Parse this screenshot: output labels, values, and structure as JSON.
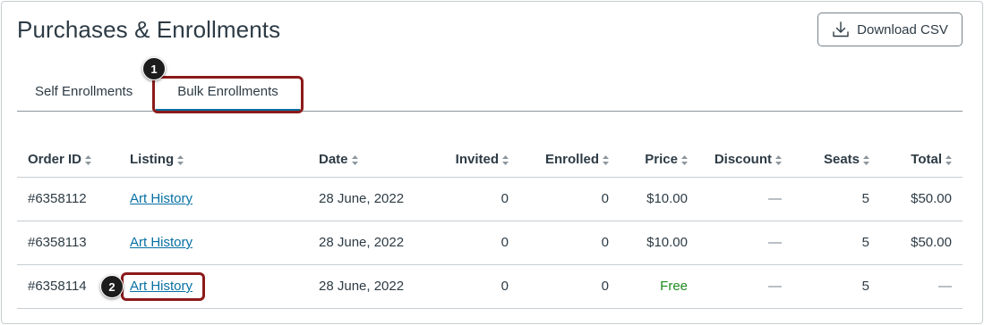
{
  "page": {
    "title": "Purchases & Enrollments"
  },
  "toolbar": {
    "download_label": "Download CSV",
    "download_icon": "download-icon"
  },
  "tabs": [
    {
      "label": "Self Enrollments",
      "active": false
    },
    {
      "label": "Bulk Enrollments",
      "active": true
    }
  ],
  "callouts": [
    "1",
    "2"
  ],
  "table": {
    "columns": [
      "Order ID",
      "Listing",
      "Date",
      "Invited",
      "Enrolled",
      "Price",
      "Discount",
      "Seats",
      "Total"
    ],
    "rows": [
      {
        "order_id": "#6358112",
        "listing": "Art History",
        "date": "28 June, 2022",
        "invited": "0",
        "enrolled": "0",
        "price": "$10.00",
        "discount": "—",
        "seats": "5",
        "total": "$50.00"
      },
      {
        "order_id": "#6358113",
        "listing": "Art History",
        "date": "28 June, 2022",
        "invited": "0",
        "enrolled": "0",
        "price": "$10.00",
        "discount": "—",
        "seats": "5",
        "total": "$50.00"
      },
      {
        "order_id": "#6358114",
        "listing": "Art History",
        "date": "28 June, 2022",
        "invited": "0",
        "enrolled": "0",
        "price": "Free",
        "discount": "—",
        "seats": "5",
        "total": "—"
      }
    ]
  },
  "colors": {
    "accent": "#0770a3",
    "callout": "#8b1a1a",
    "free": "#1f8a1f",
    "text": "#2d3b45"
  }
}
